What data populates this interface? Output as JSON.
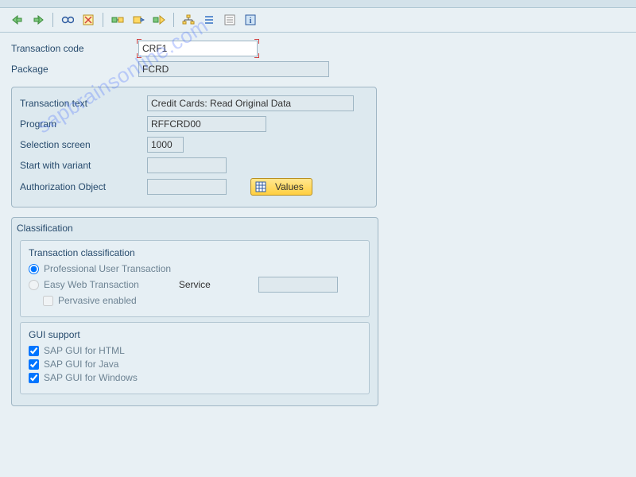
{
  "toolbar": {
    "icons": [
      "back",
      "forward",
      "glasses",
      "cancel",
      "convert",
      "export",
      "pick",
      "hierarchy",
      "align",
      "list",
      "info"
    ]
  },
  "header": {
    "tcode_label": "Transaction code",
    "tcode_value": "CRF1",
    "package_label": "Package",
    "package_value": "FCRD"
  },
  "details": {
    "text_label": "Transaction text",
    "text_value": "Credit Cards: Read Original Data",
    "program_label": "Program",
    "program_value": "RFFCRD00",
    "selscreen_label": "Selection screen",
    "selscreen_value": "1000",
    "variant_label": "Start with variant",
    "variant_value": "",
    "authobj_label": "Authorization Object",
    "authobj_value": "",
    "values_btn": "Values"
  },
  "classification": {
    "title": "Classification",
    "trans_class_title": "Transaction classification",
    "radio_prof": "Professional User Transaction",
    "radio_easy": "Easy Web Transaction",
    "service_label": "Service",
    "service_value": "",
    "pervasive_label": "Pervasive enabled",
    "gui_title": "GUI support",
    "gui_html": "SAP GUI for HTML",
    "gui_java": "SAP GUI for Java",
    "gui_win": "SAP GUI for Windows"
  },
  "watermark": "sapbrainsonline.com"
}
